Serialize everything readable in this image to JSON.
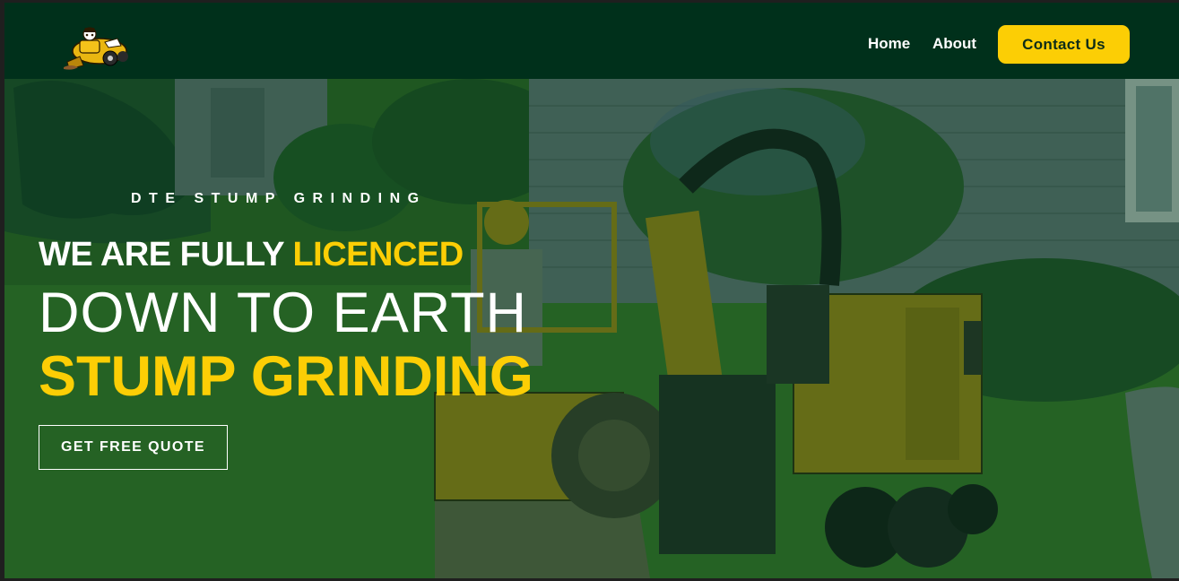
{
  "header": {
    "logo_alt": "DTE Stump Grinding logo",
    "nav": [
      {
        "label": "Home"
      },
      {
        "label": "About"
      }
    ],
    "contact_label": "Contact Us"
  },
  "hero": {
    "kicker": "DTE STUMP GRINDING",
    "line1_prefix": "WE ARE FULLY",
    "line1_highlight": "LICENCED",
    "line2": "DOWN TO EARTH",
    "line3": "STUMP GRINDING",
    "cta_label": "GET FREE QUOTE",
    "background": "photo of a stump grinding machine on a lawn"
  },
  "colors": {
    "header_bg": "#00301b",
    "accent_yellow": "#fcce05",
    "text_white": "#ffffff"
  }
}
